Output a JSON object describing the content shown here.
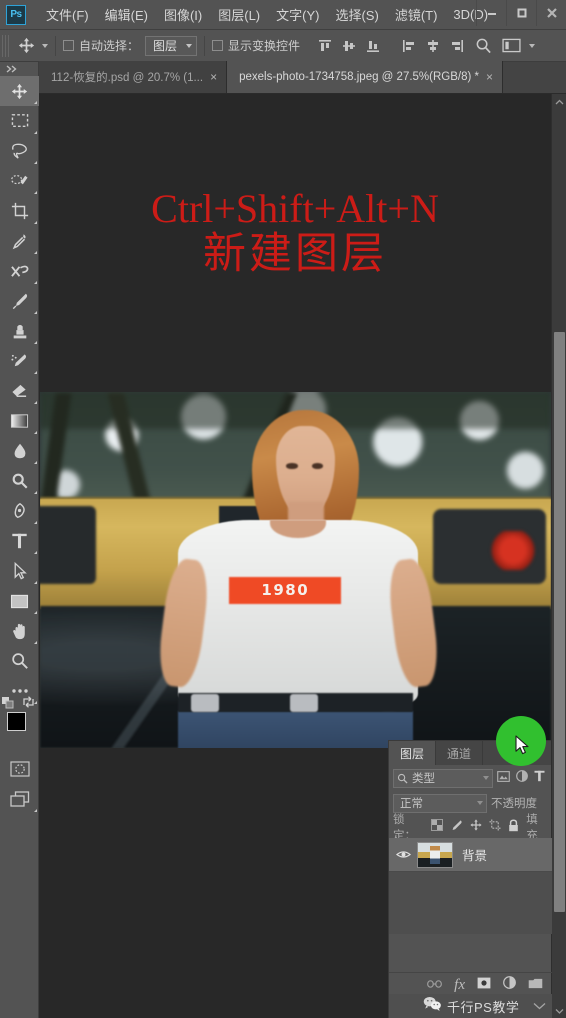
{
  "app": {
    "name": "Adobe Photoshop",
    "logo_text": "Ps",
    "accent_color": "#49c0f0",
    "chrome_bg": "#535353",
    "canvas_bg": "#282828"
  },
  "menubar": {
    "items": [
      {
        "label": "文件(F)",
        "name": "menu-file"
      },
      {
        "label": "编辑(E)",
        "name": "menu-edit"
      },
      {
        "label": "图像(I)",
        "name": "menu-image"
      },
      {
        "label": "图层(L)",
        "name": "menu-layer"
      },
      {
        "label": "文字(Y)",
        "name": "menu-type"
      },
      {
        "label": "选择(S)",
        "name": "menu-select"
      },
      {
        "label": "滤镜(T)",
        "name": "menu-filter"
      },
      {
        "label": "3D(D)",
        "name": "menu-3d"
      }
    ],
    "window_controls": [
      {
        "name": "minimize-button",
        "glyph": "minimize"
      },
      {
        "name": "maximize-button",
        "glyph": "maximize"
      },
      {
        "name": "close-button",
        "glyph": "close"
      }
    ]
  },
  "options_bar": {
    "active_tool": "move-tool",
    "auto_select_label": "自动选择：",
    "auto_select_checked": false,
    "auto_select_target": "图层",
    "show_transform_label": "显示变换控件",
    "show_transform_checked": false,
    "align_buttons": [
      {
        "name": "align-top-edges-button"
      },
      {
        "name": "align-vertical-centers-button"
      },
      {
        "name": "align-bottom-edges-button"
      },
      {
        "name": "align-left-edges-button"
      },
      {
        "name": "align-horizontal-centers-button"
      },
      {
        "name": "align-right-edges-button"
      }
    ],
    "extra_buttons": [
      {
        "name": "search-icon"
      },
      {
        "name": "arrange-documents-button"
      },
      {
        "name": "options-overflow-chevron-icon"
      }
    ]
  },
  "toolbar": {
    "tools": [
      {
        "name": "move-tool",
        "label": "移动工具",
        "active": true,
        "has_flyout": true
      },
      {
        "name": "rectangular-marquee-tool",
        "label": "矩形选框工具",
        "active": false,
        "has_flyout": true
      },
      {
        "name": "lasso-tool",
        "label": "套索工具",
        "active": false,
        "has_flyout": true
      },
      {
        "name": "quick-selection-tool",
        "label": "快速选择工具",
        "active": false,
        "has_flyout": true
      },
      {
        "name": "crop-tool",
        "label": "裁剪工具",
        "active": false,
        "has_flyout": true
      },
      {
        "name": "eyedropper-tool",
        "label": "吸管工具",
        "active": false,
        "has_flyout": true
      },
      {
        "name": "healing-brush-tool",
        "label": "修复画笔工具",
        "active": false,
        "has_flyout": true
      },
      {
        "name": "brush-tool",
        "label": "画笔工具",
        "active": false,
        "has_flyout": true
      },
      {
        "name": "clone-stamp-tool",
        "label": "仿制图章工具",
        "active": false,
        "has_flyout": true
      },
      {
        "name": "history-brush-tool",
        "label": "历史记录画笔工具",
        "active": false,
        "has_flyout": true
      },
      {
        "name": "eraser-tool",
        "label": "橡皮擦工具",
        "active": false,
        "has_flyout": true
      },
      {
        "name": "gradient-tool",
        "label": "渐变工具",
        "active": false,
        "has_flyout": true
      },
      {
        "name": "blur-tool",
        "label": "模糊工具",
        "active": false,
        "has_flyout": true
      },
      {
        "name": "dodge-tool",
        "label": "减淡工具",
        "active": false,
        "has_flyout": true
      },
      {
        "name": "pen-tool",
        "label": "钢笔工具",
        "active": false,
        "has_flyout": true
      },
      {
        "name": "horizontal-type-tool",
        "label": "横排文字工具",
        "active": false,
        "has_flyout": true
      },
      {
        "name": "path-selection-tool",
        "label": "路径选择工具",
        "active": false,
        "has_flyout": true
      },
      {
        "name": "rectangle-tool",
        "label": "矩形工具",
        "active": false,
        "has_flyout": true
      },
      {
        "name": "hand-tool",
        "label": "抓手工具",
        "active": false,
        "has_flyout": true
      },
      {
        "name": "zoom-tool",
        "label": "缩放工具",
        "active": false,
        "has_flyout": false
      },
      {
        "name": "edit-toolbar-ellipsis-button",
        "label": "编辑工具栏",
        "active": false,
        "has_flyout": true
      }
    ],
    "swatches": {
      "foreground_color": "#000000",
      "background_color": "#ffffff",
      "swap_name": "swap-colors-icon",
      "default_name": "default-colors-icon"
    },
    "bottom_buttons": [
      {
        "name": "quick-mask-button",
        "label": "以快速蒙版模式编辑"
      },
      {
        "name": "screen-mode-button",
        "label": "更改屏幕模式"
      }
    ]
  },
  "document_tabs": [
    {
      "name": "tab-112-recovered-psd",
      "label": "112-恢复的.psd @ 20.7% (1...",
      "active": false,
      "close_glyph": "×"
    },
    {
      "name": "tab-pexels-photo",
      "label": "pexels-photo-1734758.jpeg @ 27.5%(RGB/8) *",
      "active": true,
      "close_glyph": "×"
    }
  ],
  "canvas": {
    "headline_line1": "Ctrl+Shift+Alt+N",
    "headline_line2": "新建图层",
    "headline_color": "#cc1c17",
    "photo": {
      "name": "photo-woman-1980-tshirt",
      "shirt_text": "1980"
    }
  },
  "scrollbar": {
    "up_arrow_name": "scroll-up-arrow-icon",
    "down_arrow_name": "scroll-down-arrow-icon",
    "thumb_name": "vertical-scroll-thumb"
  },
  "layers_panel": {
    "tabs": [
      {
        "label": "图层",
        "name": "panel-tab-layers",
        "active": true
      },
      {
        "label": "通道",
        "name": "panel-tab-channels",
        "active": false
      }
    ],
    "filter_placeholder": "类型",
    "filter_icons": [
      {
        "name": "filter-image-icon"
      },
      {
        "name": "filter-adjustment-icon"
      },
      {
        "name": "filter-type-icon"
      }
    ],
    "blend_mode": "正常",
    "opacity_label": "不透明度",
    "lock_label": "锁定：",
    "lock_icons": [
      {
        "name": "lock-transparent-pixels-icon"
      },
      {
        "name": "lock-image-pixels-icon"
      },
      {
        "name": "lock-position-icon"
      },
      {
        "name": "lock-artboard-nesting-icon"
      },
      {
        "name": "lock-all-icon"
      }
    ],
    "fill_label": "填充",
    "layers": [
      {
        "name": "layer-row-background",
        "label": "背景",
        "visible": true
      }
    ],
    "footer_buttons": [
      {
        "name": "link-layers-icon"
      },
      {
        "name": "layer-style-fx-icon"
      },
      {
        "name": "add-layer-mask-icon"
      },
      {
        "name": "new-adjustment-layer-icon"
      },
      {
        "name": "new-group-icon"
      }
    ]
  },
  "watermark": {
    "text": "千行PS教学",
    "icon_name": "wechat-icon"
  },
  "cursor": {
    "highlight_color": "#31c02f",
    "name": "mouse-cursor-highlight"
  }
}
